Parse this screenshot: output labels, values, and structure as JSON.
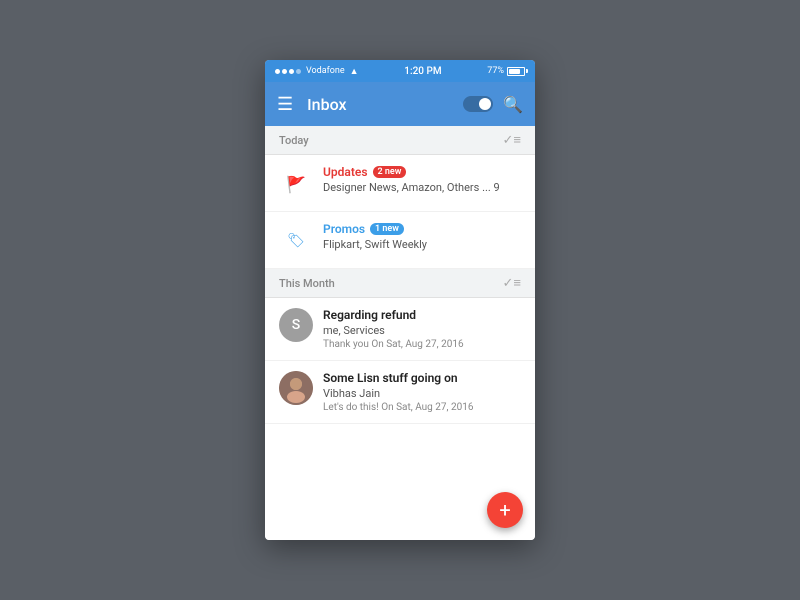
{
  "statusBar": {
    "carrier": "Vodafone",
    "time": "1:20 PM",
    "battery": "77%",
    "wifi": true
  },
  "toolbar": {
    "title": "Inbox",
    "searchLabel": "search",
    "menuLabel": "menu",
    "toggleLabel": "toggle"
  },
  "sections": {
    "today": {
      "label": "Today",
      "checkAllLabel": "✓≡"
    },
    "thisMonth": {
      "label": "This Month",
      "checkAllLabel": "✓≡"
    }
  },
  "todayItems": [
    {
      "id": "updates",
      "title": "Updates",
      "badge": "2 new",
      "subtitle": "Designer News, Amazon, Others ... 9",
      "iconType": "flag"
    },
    {
      "id": "promos",
      "title": "Promos",
      "badge": "1 new",
      "subtitle": "Flipkart, Swift Weekly",
      "iconType": "tag"
    }
  ],
  "monthItems": [
    {
      "id": "refund",
      "subject": "Regarding refund",
      "from": "me, Services",
      "preview": "Thank you On Sat, Aug 27, 2016",
      "avatarType": "letter",
      "avatarLetter": "S"
    },
    {
      "id": "lisn",
      "subject": "Some Lisn stuff going on",
      "from": "Vibhas Jain",
      "preview": "Let's do this! On Sat, Aug 27, 2016",
      "avatarType": "photo"
    }
  ],
  "fab": {
    "label": "+"
  }
}
